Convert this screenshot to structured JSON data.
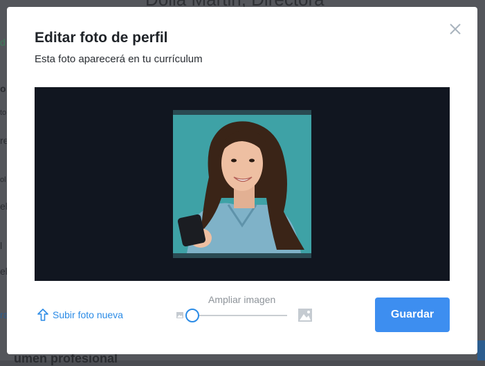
{
  "background": {
    "page_title": "Dolla Martin, Directora",
    "fragments": [
      "d",
      "o",
      "to",
      "re",
      "ol",
      "el",
      "el",
      "ra",
      "l"
    ],
    "bottom_heading": "umen profesional"
  },
  "modal": {
    "title": "Editar foto de perfil",
    "subtitle": "Esta foto aparecerá en tu currículum",
    "upload_label": "Subir foto nueva",
    "zoom_label": "Ampliar imagen",
    "zoom_level": 0,
    "save_label": "Guardar"
  },
  "colors": {
    "accent": "#3d8ef0",
    "link": "#2b8be6",
    "crop_background": "#111620",
    "photo_background": "#3ea2a6"
  },
  "icons": {
    "close": "close-icon",
    "upload": "arrow-up-icon",
    "zoom_out": "small-image-icon",
    "zoom_in": "large-image-icon"
  }
}
